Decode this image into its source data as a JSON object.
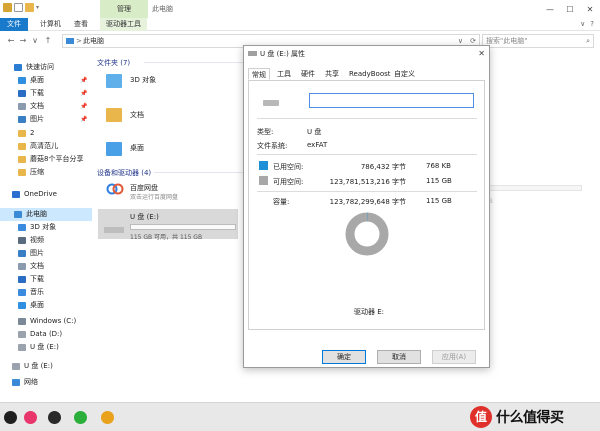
{
  "titlebar": {
    "manage_tab": "管理",
    "window_title": "此电脑",
    "minimize": "—",
    "maximize": "☐",
    "close": "✕"
  },
  "ribbon": {
    "tabs": [
      "文件",
      "计算机",
      "查看",
      "驱动器工具"
    ],
    "help": "?"
  },
  "address": {
    "back": "←",
    "forward": "→",
    "recent": "∨",
    "up": "↑",
    "crumb_sep": ">",
    "crumb": "此电脑",
    "dropdown": "∨",
    "refresh": "⟳",
    "search_placeholder": "搜索\"此电脑\""
  },
  "sidebar": {
    "items": [
      {
        "label": "快速访问",
        "icon": "star-icon",
        "color": "#2b7cd3"
      },
      {
        "label": "桌面",
        "icon": "desktop-icon",
        "color": "#2f8fe0",
        "pin": "📌"
      },
      {
        "label": "下载",
        "icon": "download-icon",
        "color": "#2b6cc4",
        "pin": "📌"
      },
      {
        "label": "文档",
        "icon": "documents-icon",
        "color": "#8a9bb0",
        "pin": "📌"
      },
      {
        "label": "图片",
        "icon": "pictures-icon",
        "color": "#3a7ec6",
        "pin": "📌"
      },
      {
        "label": "2",
        "icon": "folder-icon",
        "color": "#e8b64a"
      },
      {
        "label": "高清范儿",
        "icon": "folder-icon",
        "color": "#e8b64a"
      },
      {
        "label": "蘑菇8个平台分享",
        "icon": "folder-icon",
        "color": "#e8b64a"
      },
      {
        "label": "压缩",
        "icon": "folder-icon",
        "color": "#e8b64a"
      },
      {
        "label": "OneDrive",
        "icon": "onedrive-icon",
        "color": "#2a6fd0"
      },
      {
        "label": "此电脑",
        "icon": "pc-icon",
        "color": "#3b8ad8"
      },
      {
        "label": "3D 对象",
        "icon": "objects-3d-icon",
        "color": "#3a8be0"
      },
      {
        "label": "视频",
        "icon": "video-icon",
        "color": "#5a6b80"
      },
      {
        "label": "图片",
        "icon": "pictures-icon",
        "color": "#3a7ec6"
      },
      {
        "label": "文档",
        "icon": "documents-icon",
        "color": "#8a9bb0"
      },
      {
        "label": "下载",
        "icon": "download-icon",
        "color": "#2b6cc4"
      },
      {
        "label": "音乐",
        "icon": "music-icon",
        "color": "#3a8be0"
      },
      {
        "label": "桌面",
        "icon": "desktop-icon",
        "color": "#2f8fe0"
      },
      {
        "label": "Windows (C:)",
        "icon": "drive-c-icon",
        "color": "#7a8898"
      },
      {
        "label": "Data (D:)",
        "icon": "drive-icon",
        "color": "#9aa3ad"
      },
      {
        "label": "U 盘 (E:)",
        "icon": "usb-drive-icon",
        "color": "#9aa3ad"
      },
      {
        "label": "U 盘 (E:)",
        "icon": "usb-drive-icon",
        "color": "#9aa3ad"
      },
      {
        "label": "网络",
        "icon": "network-icon",
        "color": "#3b8ad8"
      }
    ]
  },
  "content": {
    "folders_group": "文件夹 (7)",
    "devices_group": "设备和驱动器 (4)",
    "folders": [
      {
        "label": "3D 对象",
        "icon": "objects-3d-folder-icon",
        "color": "#5fb0ea"
      },
      {
        "label": "文档",
        "icon": "documents-folder-icon",
        "color": "#e8b64a"
      },
      {
        "label": "桌面",
        "icon": "desktop-folder-icon",
        "color": "#4aa0e6"
      }
    ],
    "devices": [
      {
        "label": "百度网盘",
        "sub": "双击运行百度网盘",
        "icon": "baidu-netdisk-icon"
      },
      {
        "label": "U 盘 (E:)",
        "sub": "115 GB 可用，共 115 GB",
        "icon": "usb-drive-icon"
      }
    ],
    "ghost_text": "GB"
  },
  "dialog": {
    "title": "U 盘 (E:) 属性",
    "close": "✕",
    "tabs": [
      "常规",
      "工具",
      "硬件",
      "共享",
      "ReadyBoost",
      "自定义"
    ],
    "name_value": "",
    "type_label": "类型:",
    "type_value": "U 盘",
    "fs_label": "文件系统:",
    "fs_value": "exFAT",
    "used_label": "已用空间:",
    "used_bytes": "786,432 字节",
    "used_size": "768 KB",
    "free_label": "可用空间:",
    "free_bytes": "123,781,513,216 字节",
    "free_size": "115 GB",
    "cap_label": "容量:",
    "cap_bytes": "123,782,299,648 字节",
    "cap_size": "115 GB",
    "drive_label": "驱动器 E:",
    "used_color": "#1e90d8",
    "free_color": "#a8a8a8",
    "used_fraction": 6.4e-06,
    "buttons": {
      "ok": "确定",
      "cancel": "取消",
      "apply": "应用(A)"
    }
  },
  "taskbar": {
    "icons": [
      {
        "name": "search-icon",
        "color": "#1f1f1f"
      },
      {
        "name": "app-pink-icon",
        "color": "#e8356b"
      },
      {
        "name": "qq-icon",
        "color": "#2a2a2a"
      },
      {
        "name": "wechat-icon",
        "color": "#2bae3a"
      },
      {
        "name": "chrome-icon",
        "color": "#e8a21b"
      }
    ]
  },
  "watermark": {
    "logo": "值",
    "text": "什么值得买"
  }
}
